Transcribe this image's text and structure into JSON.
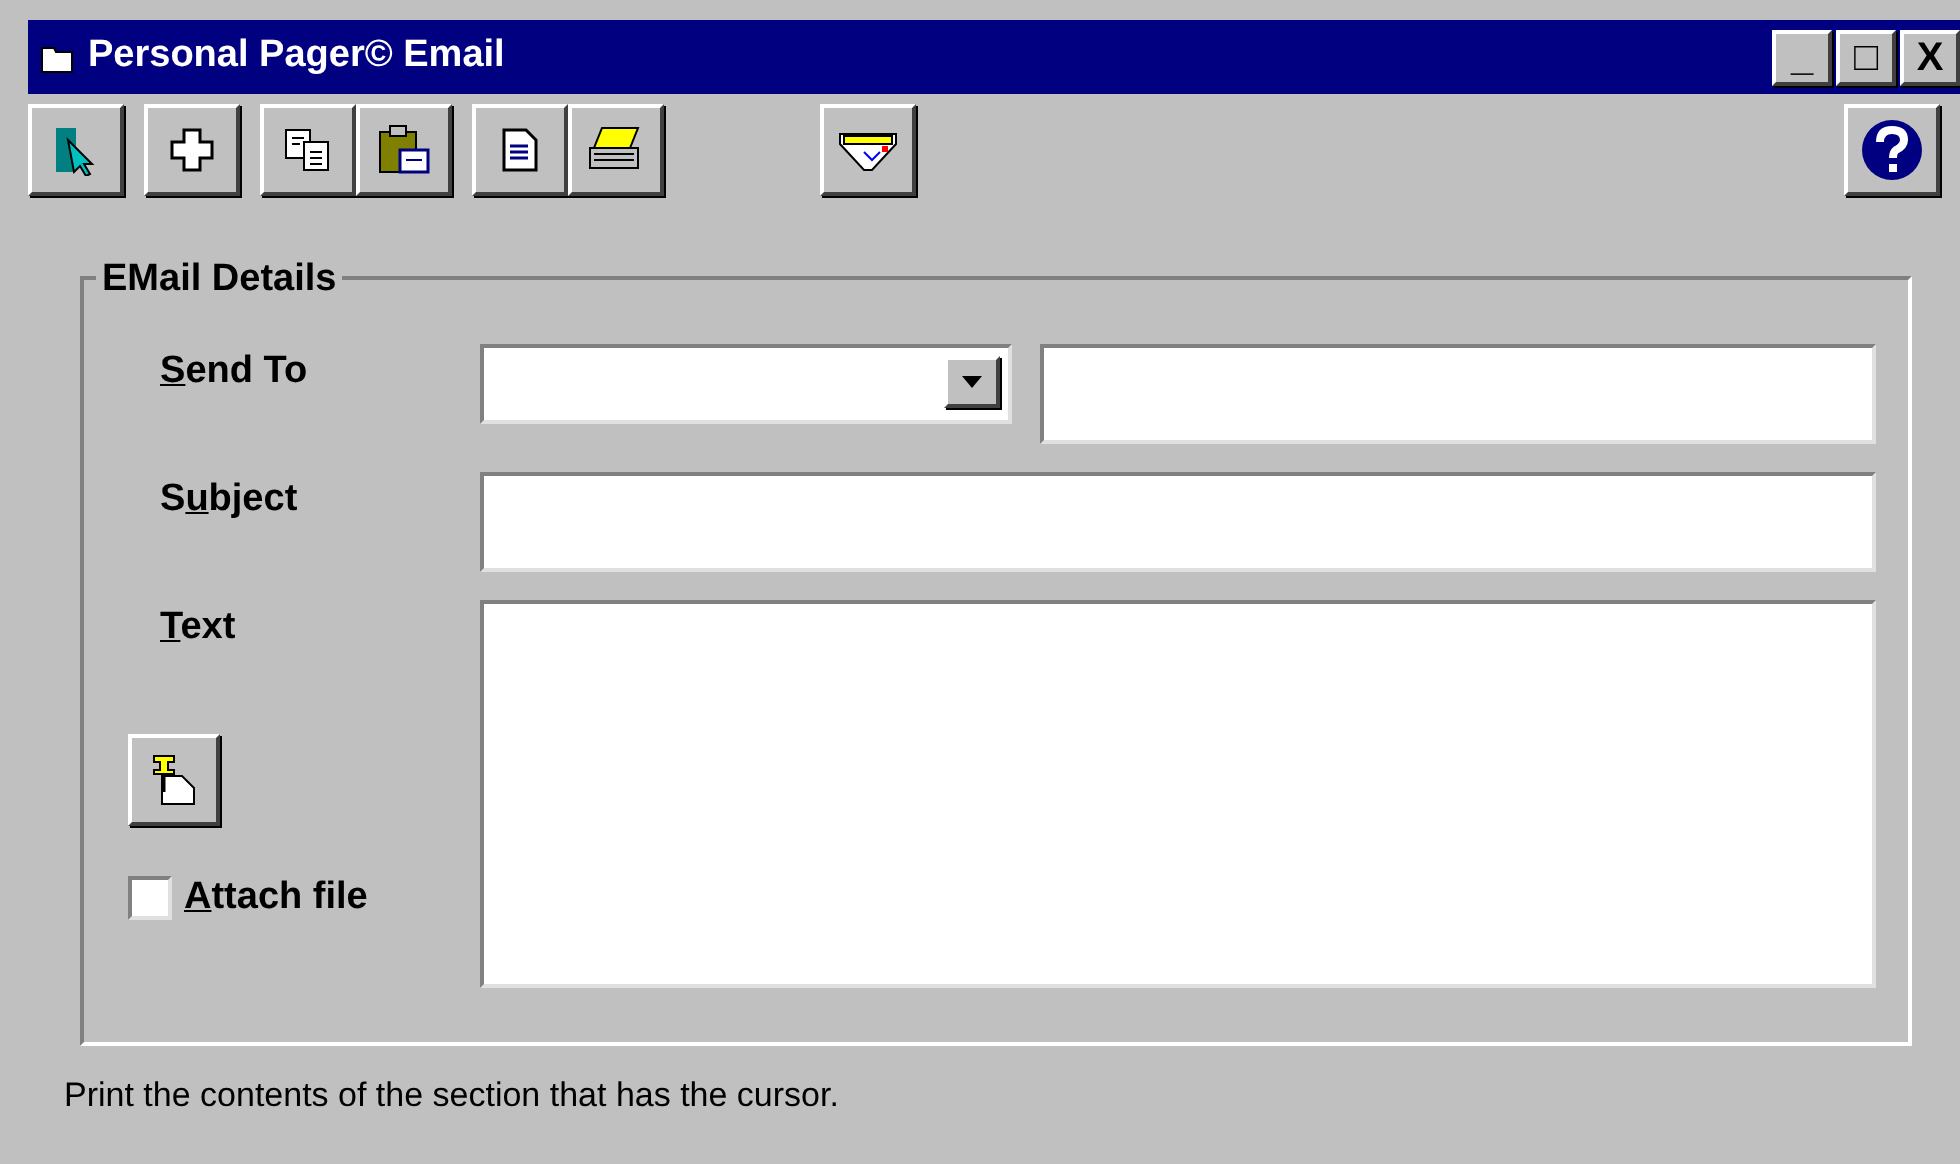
{
  "window": {
    "title": "Personal Pager© Email",
    "controls": [
      "_",
      "□",
      "X"
    ]
  },
  "toolbar": [
    {
      "kind": "exit"
    },
    {
      "kind": "add"
    },
    {
      "kind": "copy"
    },
    {
      "kind": "paste"
    },
    {
      "kind": "page"
    },
    {
      "kind": "print"
    },
    {
      "kind": "pager"
    },
    {
      "kind": "help"
    }
  ],
  "group": {
    "title": "EMail Details"
  },
  "send_to": {
    "label": {
      "key": "S",
      "after": "end To"
    }
  },
  "subject": {
    "label": {
      "before": "S",
      "key": "u",
      "after": "bject"
    }
  },
  "text": {
    "label": {
      "key": "T",
      "after": "ext"
    }
  },
  "attach": {
    "checked": false,
    "label": {
      "key": "A",
      "after": "ttach file"
    }
  },
  "status_bar": "Print the contents of the section that has the cursor."
}
